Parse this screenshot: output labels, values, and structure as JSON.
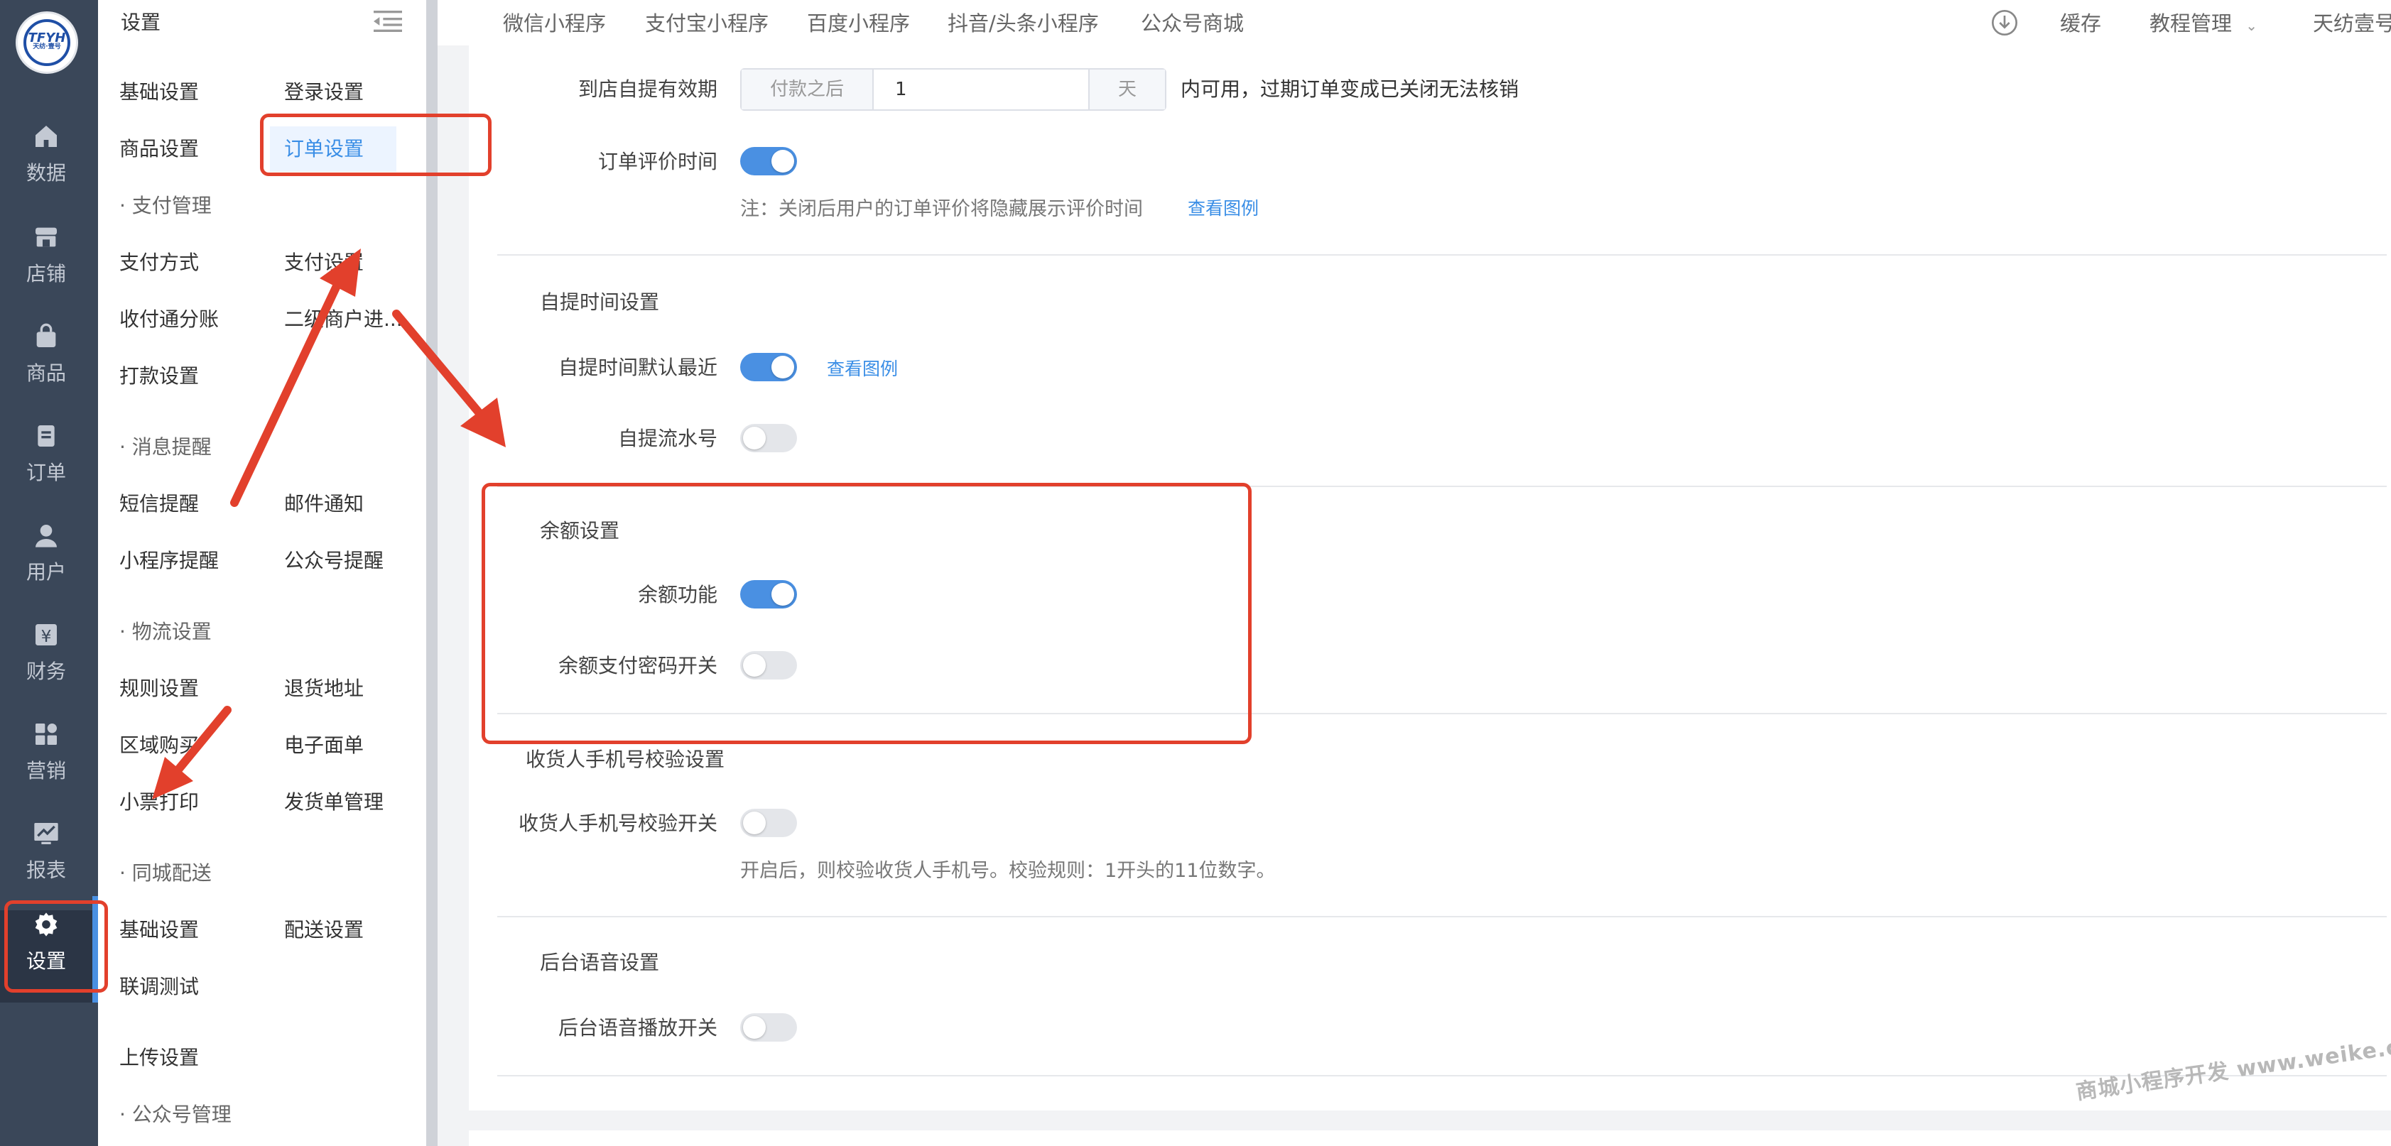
{
  "sidebar_rail": {
    "logo_text": "天纺·壹号",
    "items": [
      {
        "label": "数据",
        "icon": "home-icon"
      },
      {
        "label": "店铺",
        "icon": "store-icon"
      },
      {
        "label": "商品",
        "icon": "bag-icon"
      },
      {
        "label": "订单",
        "icon": "order-icon"
      },
      {
        "label": "用户",
        "icon": "user-icon"
      },
      {
        "label": "财务",
        "icon": "yen-icon"
      },
      {
        "label": "营销",
        "icon": "grid-icon"
      },
      {
        "label": "报表",
        "icon": "chart-icon"
      },
      {
        "label": "设置",
        "icon": "gear-icon"
      }
    ]
  },
  "submenu": {
    "header": "设置",
    "rows": [
      [
        "基础设置",
        "登录设置"
      ],
      [
        "商品设置",
        "订单设置"
      ],
      [
        "支付方式",
        "支付设置"
      ],
      [
        "收付通分账",
        "二级商户进..."
      ],
      [
        "打款设置",
        ""
      ],
      [
        "短信提醒",
        "邮件通知"
      ],
      [
        "小程序提醒",
        "公众号提醒"
      ],
      [
        "规则设置",
        "退货地址"
      ],
      [
        "区域购买",
        "电子面单"
      ],
      [
        "小票打印",
        "发货单管理"
      ],
      [
        "基础设置",
        "配送设置"
      ],
      [
        "联调测试",
        ""
      ],
      [
        "上传设置",
        ""
      ]
    ],
    "groups": [
      "· 支付管理",
      "· 消息提醒",
      "· 物流设置",
      "· 同城配送",
      "· 公众号管理"
    ],
    "active_item": "订单设置"
  },
  "topnav": {
    "items": [
      "微信小程序",
      "支付宝小程序",
      "百度小程序",
      "抖音/头条小程序",
      "公众号商城"
    ],
    "right": {
      "cache": "缓存",
      "tutorial": "教程管理",
      "account": "天纺壹号"
    }
  },
  "form": {
    "pickup_validity": {
      "label": "到店自提有效期",
      "prepend": "付款之后",
      "value": "1",
      "append": "天",
      "suffix": "内可用，过期订单变成已关闭无法核销"
    },
    "review_time": {
      "label": "订单评价时间",
      "on": true,
      "note": "注：关闭后用户的订单评价将隐藏展示评价时间",
      "link": "查看图例"
    },
    "pickup_time_section": "自提时间设置",
    "pickup_default_recent": {
      "label": "自提时间默认最近",
      "on": true,
      "link": "查看图例"
    },
    "pickup_serial": {
      "label": "自提流水号",
      "on": false
    },
    "balance_section": "余额设置",
    "balance_function": {
      "label": "余额功能",
      "on": true
    },
    "balance_password": {
      "label": "余额支付密码开关",
      "on": false
    },
    "phone_section": "收货人手机号校验设置",
    "phone_check": {
      "label": "收货人手机号校验开关",
      "on": false,
      "note": "开启后，则校验收货人手机号。校验规则：1开头的11位数字。"
    },
    "voice_section": "后台语音设置",
    "voice_play": {
      "label": "后台语音播放开关",
      "on": false
    }
  },
  "watermark": "商城小程序开发 www.weike.cc",
  "annotation_color": "#e2402c",
  "accent_color": "#4a90e2"
}
